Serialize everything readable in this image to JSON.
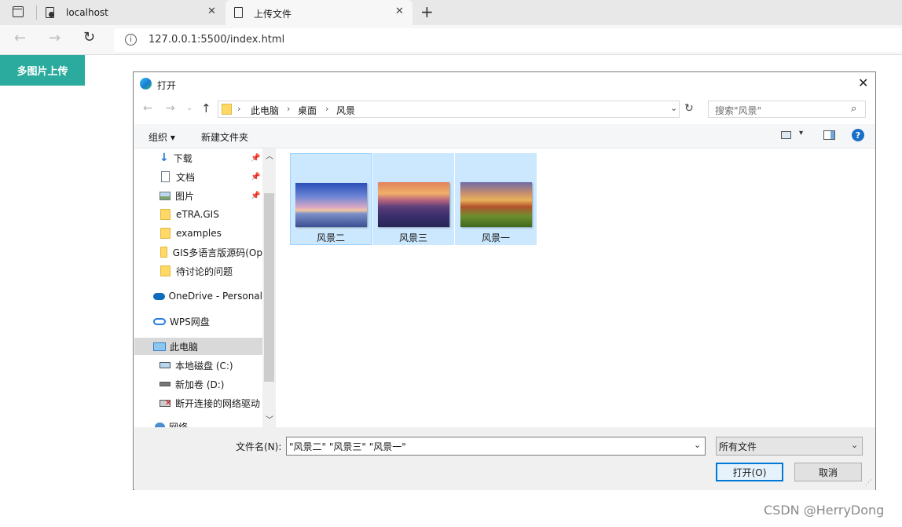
{
  "browser": {
    "tabs": [
      {
        "title": "localhost"
      },
      {
        "title": "上传文件"
      }
    ],
    "url": "127.0.0.1:5500/index.html"
  },
  "page": {
    "upload_button": "多图片上传"
  },
  "dialog": {
    "title": "打开",
    "breadcrumb": [
      "此电脑",
      "桌面",
      "风景"
    ],
    "search_placeholder": "搜索\"风景\"",
    "commands": {
      "organize": "组织 ▾",
      "new_folder": "新建文件夹"
    },
    "nav_items": [
      {
        "label": "下载",
        "icon": "download-arrow-icon",
        "pinned": true
      },
      {
        "label": "文档",
        "icon": "document-icon",
        "pinned": true
      },
      {
        "label": "图片",
        "icon": "pictures-icon",
        "pinned": true
      },
      {
        "label": "eTRA.GIS",
        "icon": "folder-icon",
        "pinned": false
      },
      {
        "label": "examples",
        "icon": "folder-icon",
        "pinned": false
      },
      {
        "label": "GIS多语言版源码(Op",
        "icon": "folder-icon",
        "pinned": false
      },
      {
        "label": "待讨论的问题",
        "icon": "folder-icon",
        "pinned": false
      },
      {
        "label": "OneDrive - Personal",
        "icon": "onedrive-cloud-icon",
        "pinned": false
      },
      {
        "label": "WPS网盘",
        "icon": "wps-cloud-icon",
        "pinned": false
      },
      {
        "label": "此电脑",
        "icon": "computer-icon",
        "pinned": false,
        "selected": true
      },
      {
        "label": "本地磁盘 (C:)",
        "icon": "drive-c-icon",
        "pinned": false
      },
      {
        "label": "新加卷 (D:)",
        "icon": "drive-d-icon",
        "pinned": false
      },
      {
        "label": "断开连接的网络驱动",
        "icon": "disconnected-drive-icon",
        "pinned": false
      },
      {
        "label": "网络",
        "icon": "network-icon",
        "pinned": false
      }
    ],
    "files": [
      {
        "name": "风景二",
        "thumbnail": "sea-sunset-thumbnail"
      },
      {
        "name": "风景三",
        "thumbnail": "mountain-sunset-thumbnail"
      },
      {
        "name": "风景一",
        "thumbnail": "autumn-field-thumbnail"
      }
    ],
    "filename_label": "文件名(N):",
    "filename_value": "\"风景二\" \"风景三\" \"风景一\"",
    "filetype_value": "所有文件",
    "open_button": "打开(O)",
    "cancel_button": "取消"
  },
  "watermark": "CSDN @HerryDong",
  "colors": {
    "upload_button": "#2bab9d",
    "selection": "#cce8ff",
    "primary_border": "#0078d7"
  }
}
